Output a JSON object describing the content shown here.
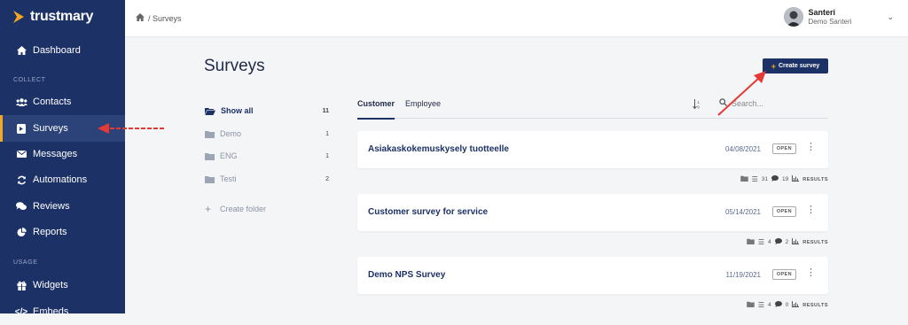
{
  "app": {
    "name": "trustmary"
  },
  "sidebar": {
    "items": [
      {
        "label": "Dashboard",
        "icon": "home-icon"
      },
      {
        "label": "Contacts",
        "icon": "users-icon"
      },
      {
        "label": "Surveys",
        "icon": "survey-icon"
      },
      {
        "label": "Messages",
        "icon": "envelope-icon"
      },
      {
        "label": "Automations",
        "icon": "sync-icon"
      },
      {
        "label": "Reviews",
        "icon": "comments-icon"
      },
      {
        "label": "Reports",
        "icon": "pie-chart-icon"
      },
      {
        "label": "Widgets",
        "icon": "gift-icon"
      },
      {
        "label": "Embeds",
        "icon": "code-icon"
      }
    ],
    "sections": {
      "collect": "COLLECT",
      "usage": "USAGE"
    }
  },
  "topbar": {
    "breadcrumb": "/ Surveys",
    "user_name": "Santeri",
    "user_org": "Demo Santeri"
  },
  "main": {
    "title": "Surveys",
    "create_label": "Create survey",
    "folders": [
      {
        "label": "Show all",
        "count": "11"
      },
      {
        "label": "Demo",
        "count": "1"
      },
      {
        "label": "ENG",
        "count": "1"
      },
      {
        "label": "Testi",
        "count": "2"
      }
    ],
    "create_folder": "Create folder",
    "tabs": [
      "Customer",
      "Employee"
    ],
    "search_placeholder": "Search...",
    "surveys": [
      {
        "title": "Asiakaskokemuskysely tuotteelle",
        "date": "04/08/2021",
        "status": "OPEN",
        "questions": "31",
        "responses": "19",
        "results": "RESULTS"
      },
      {
        "title": "Customer survey for service",
        "date": "05/14/2021",
        "status": "OPEN",
        "questions": "4",
        "responses": "2",
        "results": "RESULTS"
      },
      {
        "title": "Demo NPS Survey",
        "date": "11/19/2021",
        "status": "OPEN",
        "questions": "4",
        "responses": "0",
        "results": "RESULTS"
      }
    ]
  },
  "colors": {
    "sidebar": "#1c3166",
    "accent": "#f5a623",
    "annotation": "#e53935"
  }
}
